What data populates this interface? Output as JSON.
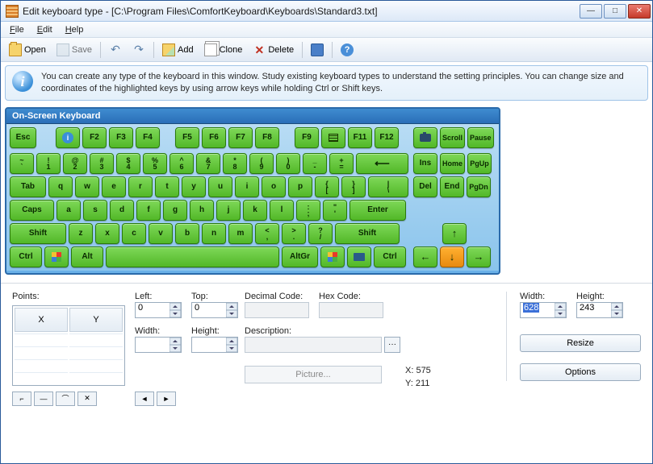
{
  "window": {
    "title": "Edit keyboard type - [C:\\Program Files\\ComfortKeyboard\\Keyboards\\Standard3.txt]"
  },
  "menu": {
    "file": "File",
    "edit": "Edit",
    "help": "Help"
  },
  "toolbar": {
    "open": "Open",
    "save": "Save",
    "add": "Add",
    "clone": "Clone",
    "delete": "Delete"
  },
  "info": {
    "text": "You can create any type of the keyboard in this window. Study existing keyboard types to understand the setting principles. You can change size and coordinates of the highlighted keys by using arrow keys while holding Ctrl or Shift keys."
  },
  "keyboard": {
    "title": "On-Screen Keyboard",
    "esc": "Esc",
    "frow": [
      "F2",
      "F3",
      "F4",
      "F5",
      "F6",
      "F7",
      "F8",
      "F9",
      "F11",
      "F12"
    ],
    "scroll": "Scroll",
    "pause": "Pause",
    "row1": {
      "tilde_top": "~",
      "tilde_bot": "`",
      "k1t": "!",
      "k1b": "1",
      "k2t": "@",
      "k2b": "2",
      "k3t": "#",
      "k3b": "3",
      "k4t": "$",
      "k4b": "4",
      "k5t": "%",
      "k5b": "5",
      "k6t": "^",
      "k6b": "6",
      "k7t": "&",
      "k7b": "7",
      "k8t": "*",
      "k8b": "8",
      "k9t": "(",
      "k9b": "9",
      "k0t": ")",
      "k0b": "0",
      "mint": "_",
      "minb": "-",
      "eqt": "+",
      "eqb": "="
    },
    "row2": {
      "tab": "Tab",
      "keys": [
        "q",
        "w",
        "e",
        "r",
        "t",
        "y",
        "u",
        "i",
        "o",
        "p"
      ],
      "br1t": "{",
      "br1b": "[",
      "br2t": "}",
      "br2b": "]",
      "bslt": "|",
      "bslb": "\\"
    },
    "row3": {
      "caps": "Caps",
      "keys": [
        "a",
        "s",
        "d",
        "f",
        "g",
        "h",
        "j",
        "k",
        "l"
      ],
      "sct": ":",
      "scb": ";",
      "qtt": "\"",
      "qtb": "'",
      "enter": "Enter"
    },
    "row4": {
      "shift": "Shift",
      "keys": [
        "z",
        "x",
        "c",
        "v",
        "b",
        "n",
        "m"
      ],
      "cmt": "<",
      "cmb": ",",
      "pdt": ">",
      "pdb": ".",
      "slt": "?",
      "slb": "/"
    },
    "row5": {
      "ctrl": "Ctrl",
      "alt": "Alt",
      "altgr": "AltGr"
    },
    "nav": {
      "ins": "Ins",
      "home": "Home",
      "pgup": "PgUp",
      "del": "Del",
      "end": "End",
      "pgdn": "PgDn"
    }
  },
  "props": {
    "points_label": "Points:",
    "x": "X",
    "y": "Y",
    "left_label": "Left:",
    "left": "0",
    "top_label": "Top:",
    "top": "0",
    "width_label": "Width:",
    "width": "",
    "height_label": "Height:",
    "height": "",
    "dec_label": "Decimal Code:",
    "hex_label": "Hex Code:",
    "desc_label": "Description:",
    "picture": "Picture...",
    "coord_x": "X: 575",
    "coord_y": "Y: 211"
  },
  "right": {
    "width_label": "Width:",
    "width": "628",
    "height_label": "Height:",
    "height": "243",
    "resize": "Resize",
    "options": "Options"
  }
}
